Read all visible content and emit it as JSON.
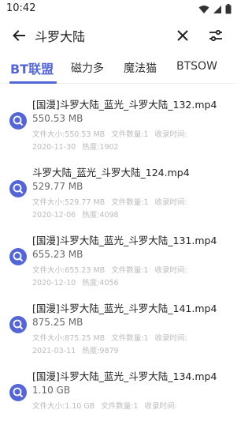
{
  "status": {
    "time": "10:42"
  },
  "search": {
    "query": "斗罗大陆"
  },
  "tabs": [
    {
      "label": "BT联盟"
    },
    {
      "label": "磁力多"
    },
    {
      "label": "魔法猫"
    },
    {
      "label": "BTSOW"
    }
  ],
  "labels": {
    "file_size": "文件大小:",
    "file_count": "文件数量:",
    "indexed": "收录时间:",
    "heat": "热度:"
  },
  "results": [
    {
      "title": "[国漫]斗罗大陆_蓝光_斗罗大陆_132.mp4",
      "size": "550.53 MB",
      "count": "1",
      "date": "2020-11-30",
      "heat": "1902"
    },
    {
      "title": "斗罗大陆_蓝光_斗罗大陆_124.mp4",
      "size": "529.77 MB",
      "count": "1",
      "date": "2020-12-06",
      "heat": "4098"
    },
    {
      "title": "[国漫]斗罗大陆_蓝光_斗罗大陆_131.mp4",
      "size": "655.23 MB",
      "count": "1",
      "date": "2020-12-10",
      "heat": "4056"
    },
    {
      "title": "[国漫]斗罗大陆_蓝光_斗罗大陆_141.mp4",
      "size": "875.25 MB",
      "count": "1",
      "date": "2021-03-11",
      "heat": "9879"
    },
    {
      "title": "[国漫]斗罗大陆_蓝光_斗罗大陆_134.mp4",
      "size": "1.10 GB",
      "count": "1",
      "date": "",
      "heat": ""
    }
  ],
  "colors": {
    "accent": "#5466d6",
    "icon_light": "#cfd6ff"
  }
}
